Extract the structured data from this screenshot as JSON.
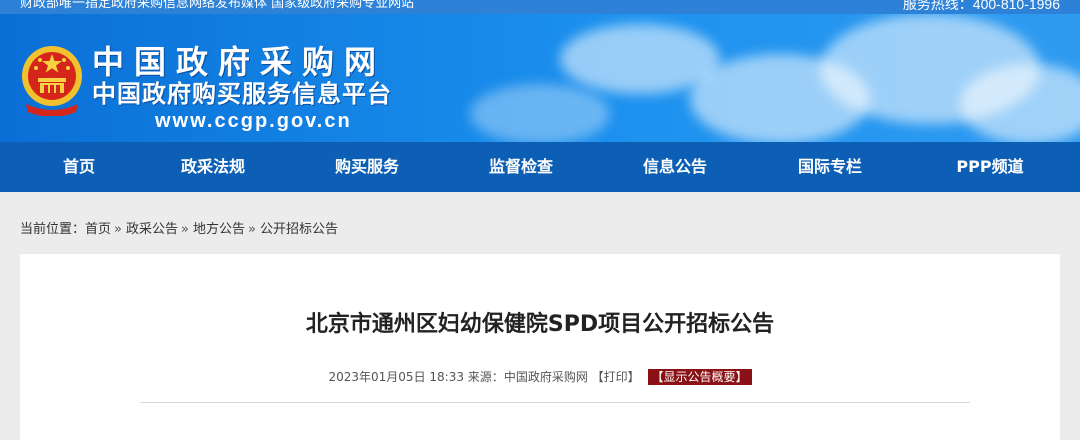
{
  "topbar": {
    "left_text": "财政部唯一指定政府采购信息网络发布媒体 国家级政府采购专业网站",
    "hotline": "服务热线：400-810-1996"
  },
  "header": {
    "site_name": "中国政府采购网",
    "subtitle": "中国政府购买服务信息平台",
    "url": "www.ccgp.gov.cn"
  },
  "nav": {
    "items": [
      "首页",
      "政采法规",
      "购买服务",
      "监督检查",
      "信息公告",
      "国际专栏",
      "PPP频道"
    ]
  },
  "breadcrumb": {
    "prefix": "当前位置：",
    "items": [
      "首页",
      "政采公告",
      "地方公告",
      "公开招标公告"
    ],
    "separator": "»"
  },
  "article": {
    "title": "北京市通州区妇幼保健院SPD项目公开招标公告",
    "datetime": "2023年01月05日 18:33",
    "source_label": "来源：",
    "source": "中国政府采购网",
    "print_label": "【打印】",
    "summary_label": "【显示公告概要】"
  },
  "colors": {
    "nav_bg": "#0c5fb4",
    "banner_blue": "#1688e8",
    "summary_button": "#8a1216"
  }
}
